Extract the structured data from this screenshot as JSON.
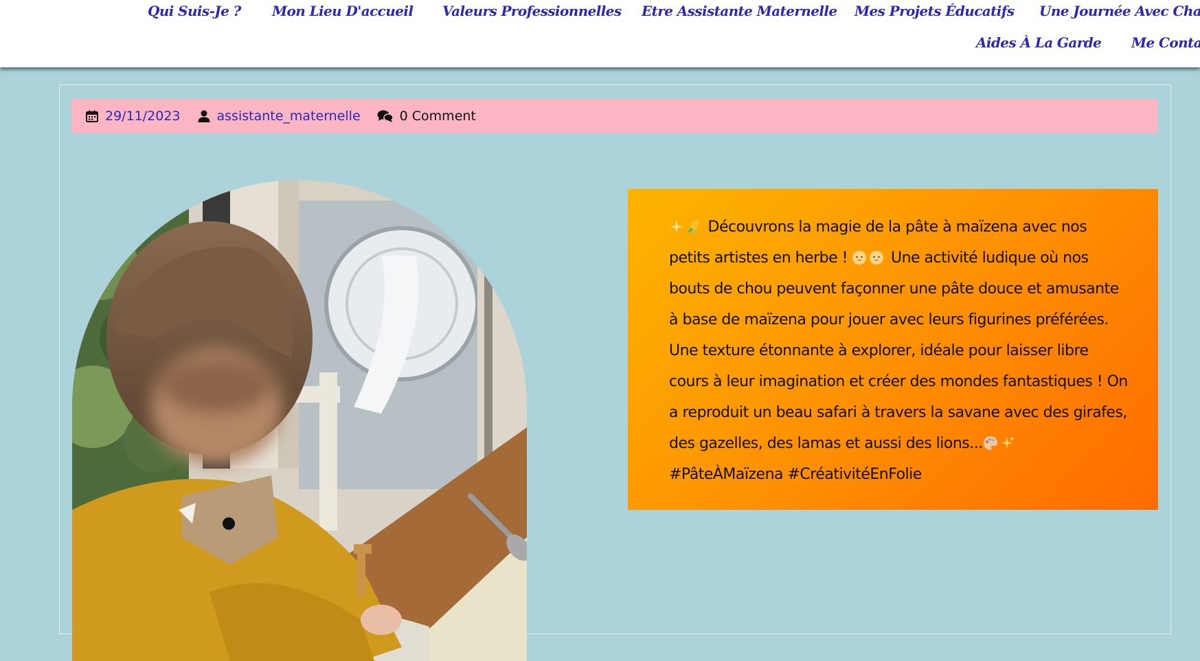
{
  "nav": {
    "items": [
      {
        "label": "Qui Suis-Je ?"
      },
      {
        "label": "Mon Lieu D'accueil"
      },
      {
        "label": "Valeurs Professionnelles"
      },
      {
        "label": "Etre Assistante Maternelle"
      },
      {
        "label": "Mes Projets Éducatifs"
      },
      {
        "label": "Une Journée Avec Charlotte"
      },
      {
        "label": "Aides À La Garde"
      },
      {
        "label": "Me Contacter"
      }
    ]
  },
  "post_meta": {
    "date": "29/11/2023",
    "author": "assistante_maternelle",
    "comments": "0 Comment",
    "icons": [
      "calendar-icon",
      "user-icon",
      "comments-icon"
    ]
  },
  "post": {
    "text_a": "Découvrons la magie de la pâte à maïzena avec nos petits artistes en herbe !",
    "text_b": "Une activité ludique où nos bouts de chou peuvent façonner une pâte douce et amusante à base de maïzena pour jouer avec leurs figurines préférées. Une texture étonnante à explorer, idéale pour laisser libre cours à leur imagination et créer des mondes fantastiques ! On a reproduit un beau safari à travers la savane avec des girafes, des gazelles, des lamas et aussi des lions...",
    "hashtags": "#PâteÀMaïzena #CréativitéEnFolie",
    "emoji_icons": [
      "sparkle-icon",
      "corn-icon",
      "baby-icon",
      "baby-icon",
      "palette-icon",
      "sparkles-icon"
    ]
  },
  "colors": {
    "page_background": "#acd3d9",
    "nav_link": "#2b28b4",
    "meta_bar": "#fbb5c3",
    "text_box_gradient_start": "#fcb400",
    "text_box_gradient_end": "#ff6c01"
  }
}
